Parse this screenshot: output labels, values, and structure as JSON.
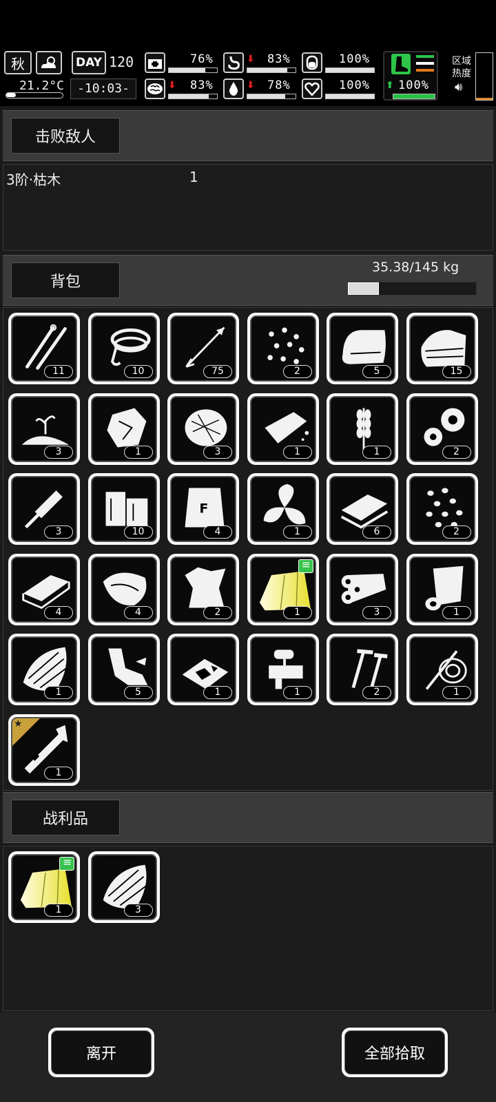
{
  "hud": {
    "season": "秋",
    "temperature": "21.2°C",
    "day_label": "DAY",
    "day_number": "120",
    "time": "-10:03-",
    "health_pct": "76%",
    "hunger_pct": "83%",
    "armor_pct": "100%",
    "mental_pct": "83%",
    "thirst_pct": "78%",
    "heart_pct": "100%",
    "stamina_pct": "100%",
    "area_label_1": "区域",
    "area_label_2": "热度",
    "health_level": 0.76,
    "hunger_level": 0.83,
    "armor_level": 1.0,
    "mental_level": 0.83,
    "thirst_level": 0.78,
    "heart_level": 1.0,
    "stamina_level": 1.0
  },
  "defeated": {
    "title": "击败敌人",
    "enemies": [
      {
        "name": "3阶·枯木",
        "count": "1"
      }
    ]
  },
  "backpack": {
    "title": "背包",
    "weight": "35.38/145 kg",
    "weight_level": 0.244,
    "items": [
      {
        "icon": "lockpick-icon",
        "count": "11"
      },
      {
        "icon": "rope-icon",
        "count": "10"
      },
      {
        "icon": "arrow-icon",
        "count": "75"
      },
      {
        "icon": "seeds-icon",
        "count": "2"
      },
      {
        "icon": "cloth-icon",
        "count": "5"
      },
      {
        "icon": "fabric-stack-icon",
        "count": "15"
      },
      {
        "icon": "soil-sprout-icon",
        "count": "3"
      },
      {
        "icon": "ore-chunks-icon",
        "count": "1"
      },
      {
        "icon": "fiber-ball-icon",
        "count": "3"
      },
      {
        "icon": "soap-bar-icon",
        "count": "1"
      },
      {
        "icon": "wheat-icon",
        "count": "1"
      },
      {
        "icon": "gears-icon",
        "count": "2"
      },
      {
        "icon": "spindle-tool-icon",
        "count": "3"
      },
      {
        "icon": "wood-blocks-icon",
        "count": "10"
      },
      {
        "icon": "flour-bag-icon",
        "count": "4"
      },
      {
        "icon": "herb-leaves-icon",
        "count": "1"
      },
      {
        "icon": "bread-slices-icon",
        "count": "6"
      },
      {
        "icon": "beans-icon",
        "count": "2"
      },
      {
        "icon": "metal-ingot-icon",
        "count": "4"
      },
      {
        "icon": "meat-chunk-icon",
        "count": "4"
      },
      {
        "icon": "leather-hide-icon",
        "count": "2"
      },
      {
        "icon": "yellow-cloth-icon",
        "count": "1",
        "flag": true
      },
      {
        "icon": "logs-icon",
        "count": "3"
      },
      {
        "icon": "paper-roll-icon",
        "count": "1"
      },
      {
        "icon": "wood-shavings-icon",
        "count": "1"
      },
      {
        "icon": "scrap-parts-icon",
        "count": "5"
      },
      {
        "icon": "glass-shards-icon",
        "count": "1"
      },
      {
        "icon": "machine-part-icon",
        "count": "1"
      },
      {
        "icon": "screws-icon",
        "count": "2"
      },
      {
        "icon": "wire-coil-icon",
        "count": "1"
      },
      {
        "icon": "caliper-tool-icon",
        "count": "1",
        "star": true
      }
    ]
  },
  "loot": {
    "title": "战利品",
    "items": [
      {
        "icon": "yellow-cloth-icon",
        "count": "1",
        "flag": true
      },
      {
        "icon": "wood-shavings-icon",
        "count": "3"
      }
    ]
  },
  "actions": {
    "leave_label": "离开",
    "take_all_label": "全部拾取"
  }
}
